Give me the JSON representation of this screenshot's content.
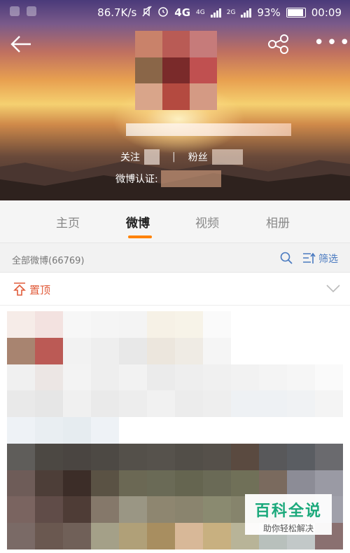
{
  "status_bar": {
    "network_speed": "86.7K/s",
    "network_type": "4G",
    "network_type_2": "4G",
    "network_type_3": "2G",
    "battery": "93%",
    "time": "00:09"
  },
  "header": {
    "back_icon": "arrow-left-icon",
    "share_icon": "share-icon",
    "more_icon": "more-horizontal-icon",
    "follow_label": "关注",
    "fans_label": "粉丝",
    "divider": "|",
    "verify_label": "微博认证:"
  },
  "tabs": [
    {
      "label": "主页",
      "active": false
    },
    {
      "label": "微博",
      "active": true
    },
    {
      "label": "视频",
      "active": false
    },
    {
      "label": "相册",
      "active": false
    }
  ],
  "filter_bar": {
    "count_label": "全部微博(66769)",
    "filter_label": "筛选"
  },
  "pinned": {
    "label": "置顶"
  },
  "colors": {
    "accent": "#ff8200",
    "link_blue": "#4a7ac0",
    "pinned_red": "#e15b3a"
  },
  "watermark": {
    "title": "百科全说",
    "subtitle": "助你轻松解决"
  }
}
